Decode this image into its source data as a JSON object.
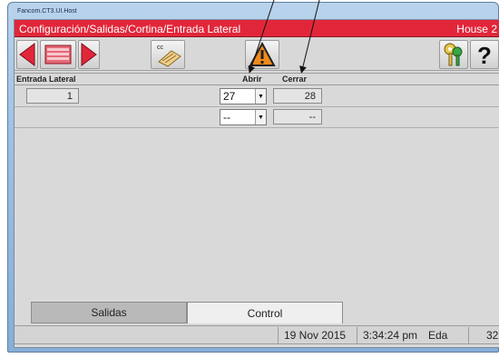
{
  "window": {
    "title": "Fancom.CT3.UI.Host"
  },
  "header": {
    "path": "Configuración/Salidas/Cortina/Entrada Lateral",
    "house": "House 2"
  },
  "toolbar": {
    "cc_label": "cc"
  },
  "table": {
    "columns": {
      "name": "Entrada Lateral",
      "open": "Abrir",
      "close": "Cerrar"
    },
    "rows": [
      {
        "index": "1",
        "open": "27",
        "close": "28"
      },
      {
        "index": "",
        "open": "--",
        "close": "--"
      }
    ]
  },
  "tabs": [
    {
      "label": "Salidas",
      "selected": false
    },
    {
      "label": "Control",
      "selected": true
    }
  ],
  "status": {
    "date": "19 Nov 2015",
    "time": "3:34:24 pm",
    "user": "Eda",
    "number": "32"
  },
  "colors": {
    "header_red": "#e2263a",
    "arrow_red": "#e2263a",
    "warning_orange": "#f08a1c"
  },
  "icons": [
    "arrow-left-icon",
    "list-icon",
    "arrow-right-icon",
    "cc-card-icon",
    "warning-icon",
    "keys-icon",
    "help-icon"
  ]
}
